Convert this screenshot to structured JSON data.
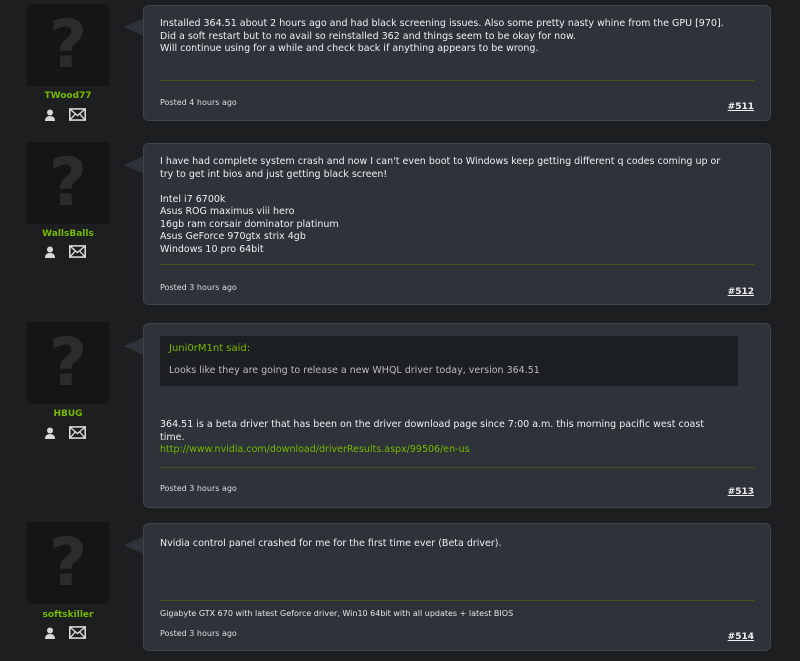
{
  "posts": [
    {
      "username": "TWood77",
      "message": [
        "Installed 364.51 about 2 hours ago and had black screening issues. Also some pretty nasty whine from the GPU [970].",
        "Did a soft restart but to no avail so reinstalled 362 and things seem to be okay for now.",
        "Will continue using for a while and check back if anything appears to be wrong."
      ],
      "posted": "Posted 4 hours ago",
      "number": "#511"
    },
    {
      "username": "WallsBalls",
      "message": [
        "I have had complete system crash and now I can't even boot to Windows keep getting different q codes coming up or",
        "try to get int bios and just getting black screen!",
        "",
        "Intel i7 6700k",
        "Asus ROG maximus viii hero",
        "16gb ram corsair dominator platinum",
        "Asus GeForce 970gtx strix 4gb",
        "Windows 10 pro 64bit"
      ],
      "posted": "Posted 3 hours ago",
      "number": "#512"
    },
    {
      "username": "HBUG",
      "quote_author": "Juni0rM1nt said:",
      "quote_text": "Looks like they are going to release a new WHQL driver today, version 364.51",
      "message": [
        "364.51 is a beta driver that has been on the driver download page since 7:00 a.m. this morning pacific west coast",
        "time."
      ],
      "link": "http://www.nvidia.com/download/driverResults.aspx/99506/en-us",
      "posted": "Posted 3 hours ago",
      "number": "#513"
    },
    {
      "username": "softskiller",
      "message": [
        "Nvidia control panel crashed for me for the first time ever (Beta driver)."
      ],
      "signature": "Gigabyte GTX 670 with latest Geforce driver, Win10 64bit with all updates + latest BIOS",
      "posted": "Posted 3 hours ago",
      "number": "#514"
    }
  ],
  "icons": {
    "profile": "user-icon",
    "message": "envelope-icon"
  },
  "colors": {
    "accent": "#76b900",
    "bubble": "#2d3338",
    "background": "#1c1e20"
  }
}
